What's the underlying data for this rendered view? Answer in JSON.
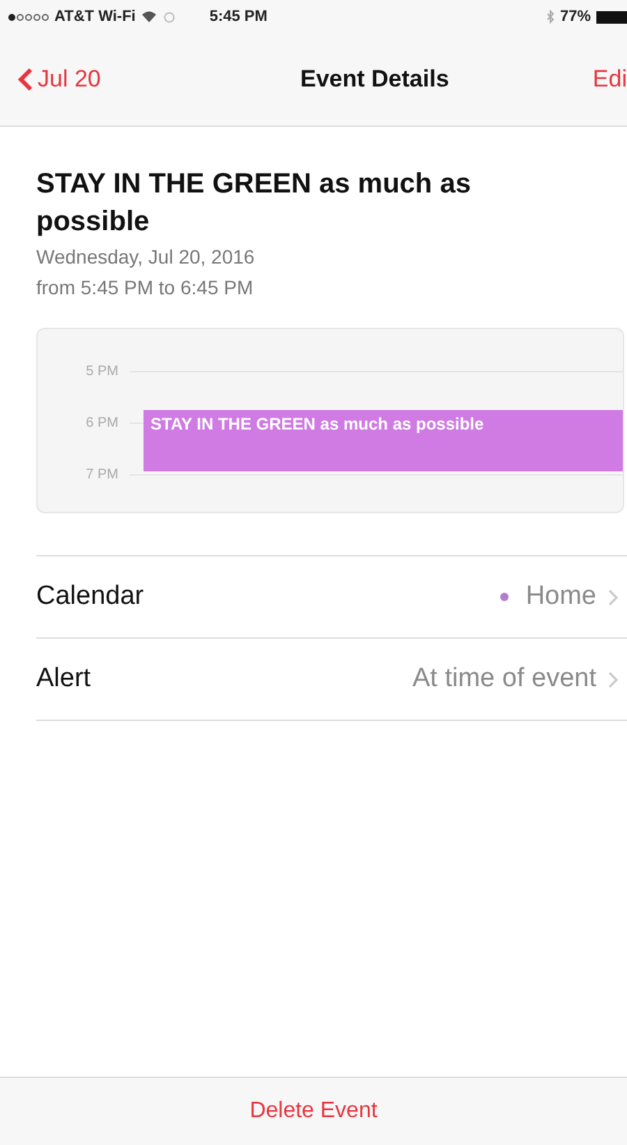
{
  "status_bar": {
    "carrier": "AT&T Wi-Fi",
    "time": "5:45 PM",
    "battery": "77%"
  },
  "nav": {
    "back": "Jul 20",
    "title": "Event Details",
    "action": "Edi"
  },
  "event": {
    "title": "STAY IN THE GREEN as much as possible",
    "date": "Wednesday, Jul 20, 2016",
    "time_range": "from 5:45 PM to 6:45 PM"
  },
  "timeline": {
    "hours": [
      "5 PM",
      "6 PM",
      "7 PM"
    ],
    "event_label": "STAY IN THE GREEN as much as possible"
  },
  "rows": [
    {
      "kind": "calendar",
      "label": "Calendar",
      "value": "Home",
      "color": "#b57ccc"
    },
    {
      "kind": "alert",
      "label": "Alert",
      "value": "At time of event"
    }
  ],
  "delete_button": "Delete Event"
}
